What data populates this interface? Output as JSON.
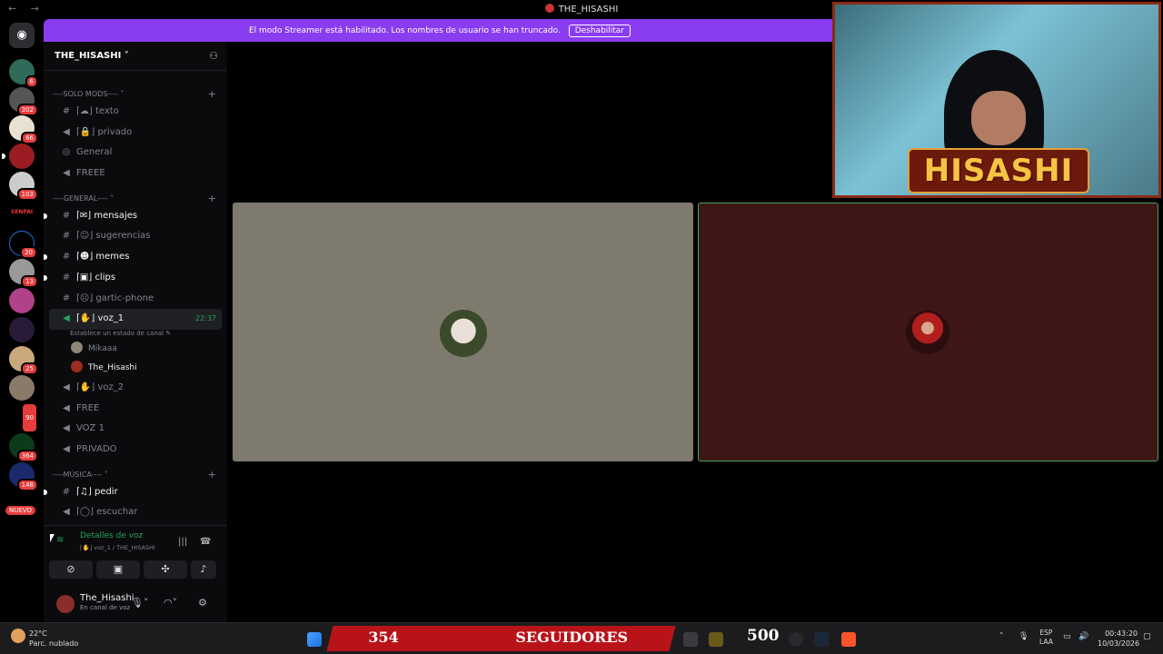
{
  "window": {
    "title": "THE_HISASHI",
    "nav": "← →"
  },
  "banner": {
    "text": "El modo Streamer está habilitado. Los nombres de usuario se han truncado.",
    "button": "Deshabilitar"
  },
  "rail": {
    "badges": [
      "6",
      "302",
      "66",
      "",
      "103",
      "",
      "20",
      "13",
      "",
      "",
      "25",
      "",
      "90",
      "364",
      "148"
    ],
    "nuevo": "NUEVO"
  },
  "server": {
    "name": "THE_HISASHI"
  },
  "categories": {
    "solo_mods": "----SOLO MODS----",
    "general": "----GENERAL----",
    "musica": "----MÚSICA----"
  },
  "channels": {
    "texto": "texto",
    "privado": "privado",
    "general_stage": "General",
    "freee": "FREEE",
    "mensajes": "mensajes",
    "sugerencias": "sugerencias",
    "memes": "memes",
    "clips": "clips",
    "gartic": "gartic-phone",
    "voz1": "voz_1",
    "voz1_time": "22:37",
    "voz1_status": "Establece un estado de canal",
    "voz2": "voz_2",
    "free": "FREE",
    "voz_1b": "VOZ 1",
    "privado_voice": "PRIVADO",
    "pedir": "pedir",
    "escuchar": "escuchar"
  },
  "voice_users": [
    "Mikaaa",
    "The_Hisashi"
  ],
  "voice_panel": {
    "status": "Detalles de voz",
    "location": "voz_1 / THE_HISASHI"
  },
  "user": {
    "name": "The_Hisashi",
    "status": "En canal de voz"
  },
  "stream": {
    "overlay_name": "HISASHI"
  },
  "taskbar": {
    "temp": "22°C",
    "weather": "Parc. nublado",
    "followers_count": "354",
    "followers_label": "SEGUIDORES",
    "goal": "500",
    "lang_top": "ESP",
    "lang_bottom": "LAA",
    "time": "00:43:20",
    "date": "10/03/2026"
  }
}
